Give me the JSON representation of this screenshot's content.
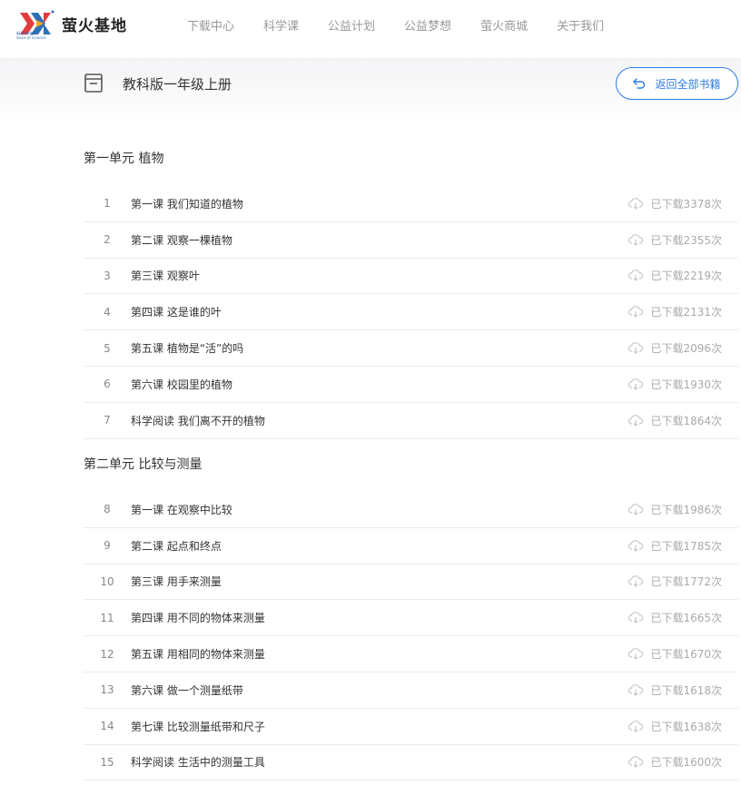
{
  "brand": {
    "name": "萤火基地",
    "logo_tagline": "科学声音",
    "logo_subtitle": "Voice of Science"
  },
  "nav": [
    "下载中心",
    "科学课",
    "公益计划",
    "公益梦想",
    "萤火商城",
    "关于我们"
  ],
  "book": {
    "title": "教科版一年级上册",
    "back_label": "返回全部书籍"
  },
  "units": [
    {
      "title": "第一单元 植物",
      "lessons": [
        {
          "num": "1",
          "name": "第一课 我们知道的植物",
          "downloads": "已下载3378次"
        },
        {
          "num": "2",
          "name": "第二课 观察一棵植物",
          "downloads": "已下载2355次"
        },
        {
          "num": "3",
          "name": "第三课 观察叶",
          "downloads": "已下载2219次"
        },
        {
          "num": "4",
          "name": "第四课 这是谁的叶",
          "downloads": "已下载2131次"
        },
        {
          "num": "5",
          "name": "第五课 植物是“活”的吗",
          "downloads": "已下载2096次"
        },
        {
          "num": "6",
          "name": "第六课 校园里的植物",
          "downloads": "已下载1930次"
        },
        {
          "num": "7",
          "name": "科学阅读 我们离不开的植物",
          "downloads": "已下载1864次"
        }
      ]
    },
    {
      "title": "第二单元 比较与测量",
      "lessons": [
        {
          "num": "8",
          "name": "第一课 在观察中比较",
          "downloads": "已下载1986次"
        },
        {
          "num": "9",
          "name": "第二课 起点和终点",
          "downloads": "已下载1785次"
        },
        {
          "num": "10",
          "name": "第三课 用手来测量",
          "downloads": "已下载1772次"
        },
        {
          "num": "11",
          "name": "第四课 用不同的物体来测量",
          "downloads": "已下载1665次"
        },
        {
          "num": "12",
          "name": "第五课 用相同的物体来测量",
          "downloads": "已下载1670次"
        },
        {
          "num": "13",
          "name": "第六课 做一个测量纸带",
          "downloads": "已下载1618次"
        },
        {
          "num": "14",
          "name": "第七课 比较测量纸带和尺子",
          "downloads": "已下载1638次"
        },
        {
          "num": "15",
          "name": "科学阅读 生活中的测量工具",
          "downloads": "已下载1600次"
        }
      ]
    }
  ],
  "icons": {
    "download": "cloud-download-icon",
    "back": "return-arrow-icon",
    "book": "book-icon"
  },
  "colors": {
    "accent": "#2c7be5",
    "muted": "#aaaaaa"
  }
}
